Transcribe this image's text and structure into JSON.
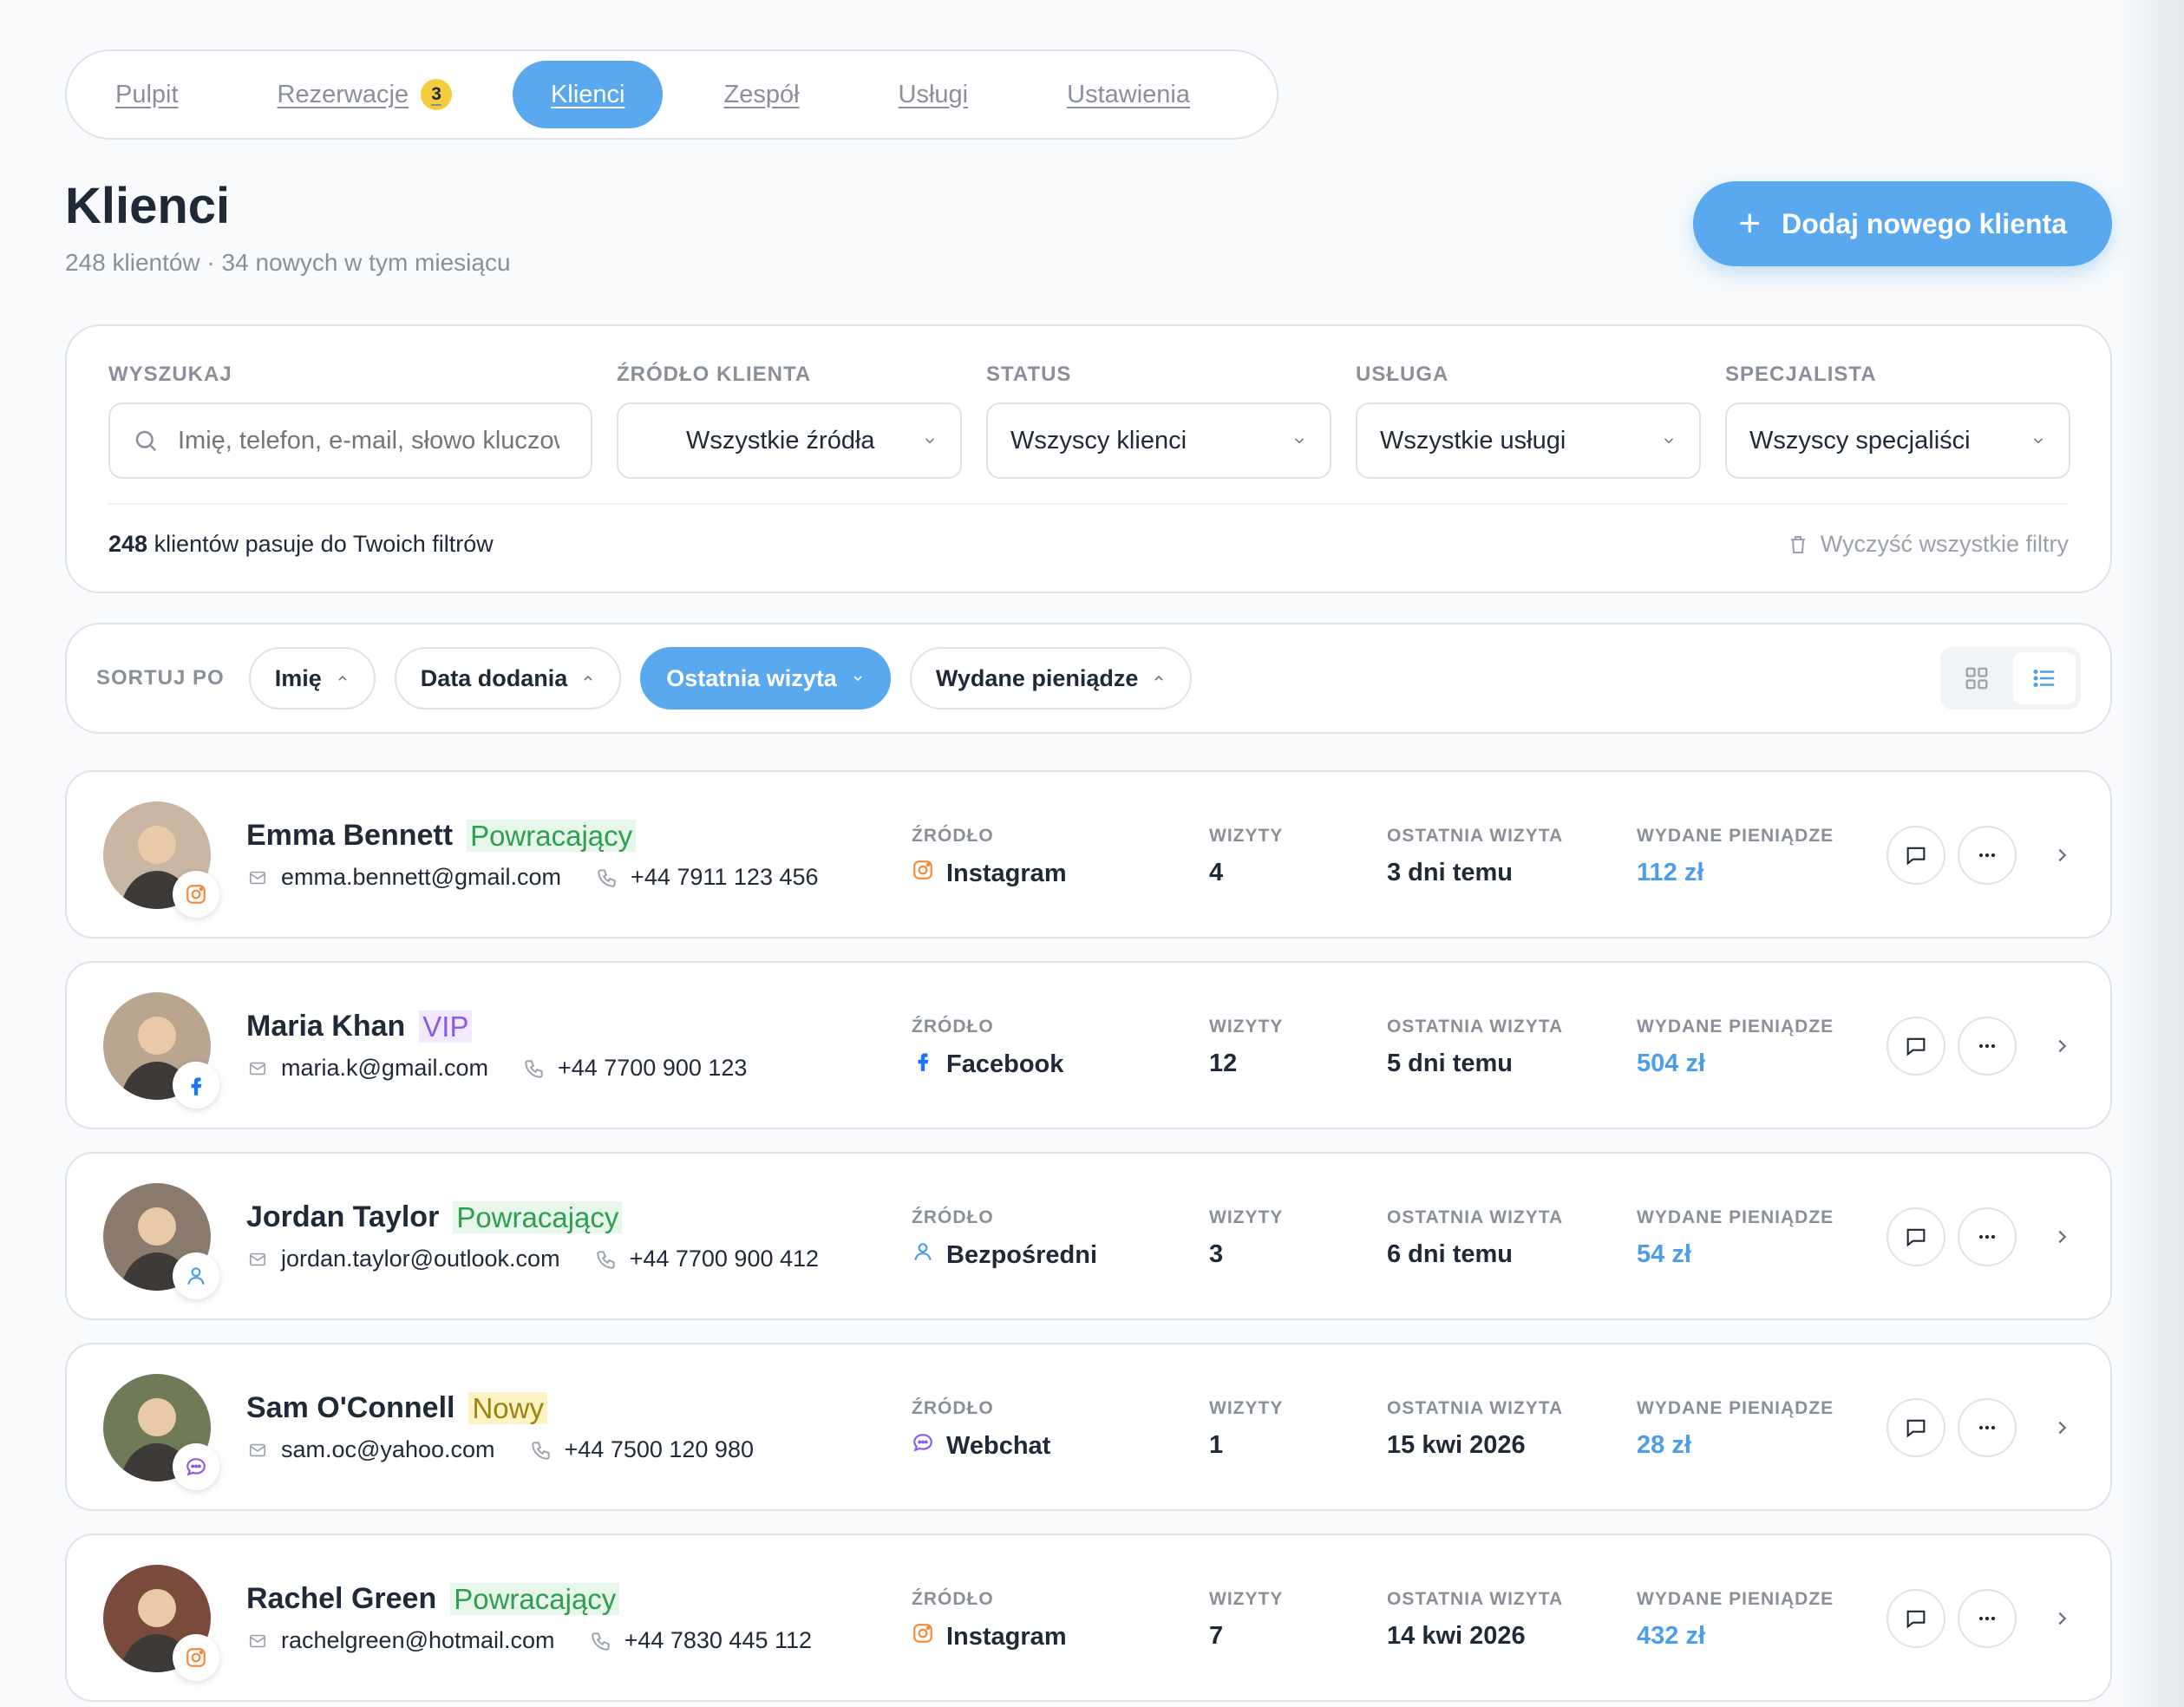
{
  "nav": {
    "items": [
      {
        "label": "Pulpit"
      },
      {
        "label": "Rezerwacje",
        "badge": "3"
      },
      {
        "label": "Klienci",
        "active": true
      },
      {
        "label": "Zespół"
      },
      {
        "label": "Usługi"
      },
      {
        "label": "Ustawienia"
      }
    ]
  },
  "header": {
    "title": "Klienci",
    "subtitle": "248 klientów · 34 nowych w tym miesiącu",
    "add_button": "Dodaj nowego klienta"
  },
  "filters": {
    "search": {
      "label": "WYSZUKAJ",
      "placeholder": "Imię, telefon, e-mail, słowo kluczowe"
    },
    "source": {
      "label": "ŹRÓDŁO KLIENTA",
      "value": "Wszystkie źródła"
    },
    "status": {
      "label": "STATUS",
      "value": "Wszyscy klienci"
    },
    "service": {
      "label": "USŁUGA",
      "value": "Wszystkie usługi"
    },
    "specialist": {
      "label": "SPECJALISTA",
      "value": "Wszyscy specjaliści"
    },
    "match_count": "248",
    "match_text": " klientów pasuje do Twoich filtrów",
    "clear": "Wyczyść wszystkie filtry"
  },
  "sort": {
    "label": "SORTUJ PO",
    "options": [
      {
        "label": "Imię",
        "active": false
      },
      {
        "label": "Data dodania",
        "active": false
      },
      {
        "label": "Ostatnia wizyta",
        "active": true
      },
      {
        "label": "Wydane pieniądze",
        "active": false
      }
    ],
    "view_mode": "list"
  },
  "columns": {
    "source": "ŹRÓDŁO",
    "visits": "WIZYTY",
    "last_visit": "OSTATNIA WIZYTA",
    "spent": "WYDANE PIENIĄDZE"
  },
  "clients": [
    {
      "name": "Emma Bennett",
      "tag": "Powracający",
      "tag_color": "green",
      "email": "emma.bennett@gmail.com",
      "phone": "+44 7911 123 456",
      "source": "Instagram",
      "source_icon": "instagram-icon",
      "visits": "4",
      "last_visit": "3 dni temu",
      "spent": "112 zł",
      "avatar_bg": "#c9b6a3"
    },
    {
      "name": "Maria Khan",
      "tag": "VIP",
      "tag_color": "purple",
      "email": "maria.k@gmail.com",
      "phone": "+44 7700 900 123",
      "source": "Facebook",
      "source_icon": "facebook-icon",
      "visits": "12",
      "last_visit": "5 dni temu",
      "spent": "504 zł",
      "avatar_bg": "#b9a590"
    },
    {
      "name": "Jordan Taylor",
      "tag": "Powracający",
      "tag_color": "green",
      "email": "jordan.taylor@outlook.com",
      "phone": "+44 7700 900 412",
      "source": "Bezpośredni",
      "source_icon": "person-icon",
      "visits": "3",
      "last_visit": "6 dni temu",
      "spent": "54 zł",
      "avatar_bg": "#8a7b6c"
    },
    {
      "name": "Sam O'Connell",
      "tag": "Nowy",
      "tag_color": "yellow",
      "email": "sam.oc@yahoo.com",
      "phone": "+44 7500 120 980",
      "source": "Webchat",
      "source_icon": "chat-icon",
      "visits": "1",
      "last_visit": "15 kwi 2026",
      "spent": "28 zł",
      "avatar_bg": "#6f7a58"
    },
    {
      "name": "Rachel Green",
      "tag": "Powracający",
      "tag_color": "green",
      "email": "rachelgreen@hotmail.com",
      "phone": "+44 7830 445 112",
      "source": "Instagram",
      "source_icon": "instagram-icon",
      "visits": "7",
      "last_visit": "14 kwi 2026",
      "spent": "432 zł",
      "avatar_bg": "#7a4a3c"
    }
  ],
  "colors": {
    "accent": "#5aa8ee",
    "money": "#4d9ee8",
    "instagram": "#f08a3c",
    "facebook": "#1877f2",
    "direct": "#4d9ee8",
    "webchat": "#8d5ae0"
  }
}
